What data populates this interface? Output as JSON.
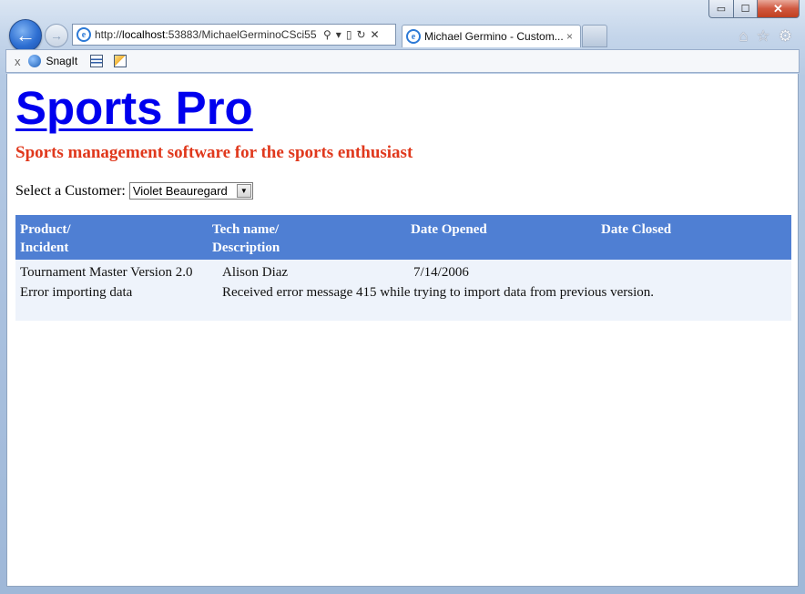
{
  "browser": {
    "address_url_prefix": "http://",
    "address_host": "localhost",
    "address_rest": ":53883/MichaelGerminoCSci55",
    "tab_title": "Michael Germino - Custom...",
    "tab_close": "×",
    "back_glyph": "←",
    "forward_glyph": "→",
    "window_minimize": "▭",
    "window_maximize": "☐",
    "window_close": "✕",
    "icons": {
      "back": "back-arrow-icon",
      "forward": "forward-arrow-icon",
      "page": "ie-page-icon",
      "search": "search-icon",
      "compat": "compatibility-view-icon",
      "refresh": "refresh-icon",
      "stop": "stop-icon",
      "home": "home-icon",
      "favorites": "star-icon",
      "tools": "gear-icon"
    },
    "home_glyph": "⌂",
    "favorites_glyph": "☆",
    "tools_glyph": "⚙",
    "search_glyph": "⚲",
    "dropdown_glyph": "▾",
    "compat_glyph": "▯",
    "refresh_glyph": "↻",
    "stop_glyph": "✕",
    "ie_glyph": "e"
  },
  "commandbar": {
    "close_glyph": "x",
    "snagit_label": "SnagIt"
  },
  "page": {
    "site_title": "Sports Pro",
    "tagline": "Sports management software for the sports enthusiast",
    "customer_label": "Select a Customer:",
    "customer_selected": "Violet Beauregard",
    "select_arrow": "▼",
    "columns": [
      {
        "line1": "Product/",
        "line2": "Incident"
      },
      {
        "line1": "Tech name/",
        "line2": "Description"
      },
      {
        "line1": "Date Opened",
        "line2": ""
      },
      {
        "line1": "Date Closed",
        "line2": ""
      }
    ],
    "rows": [
      {
        "product": "Tournament Master Version 2.0",
        "tech": "Alison Diaz",
        "date_opened": "7/14/2006",
        "date_closed": "",
        "incident": "Error importing data",
        "description": "Received error message 415 while trying to import data from previous version."
      }
    ]
  },
  "colors": {
    "title_link": "#0000ee",
    "tagline": "#e0381c",
    "header_bg": "#4f7fd3",
    "row_bg": "#eef3fb"
  }
}
